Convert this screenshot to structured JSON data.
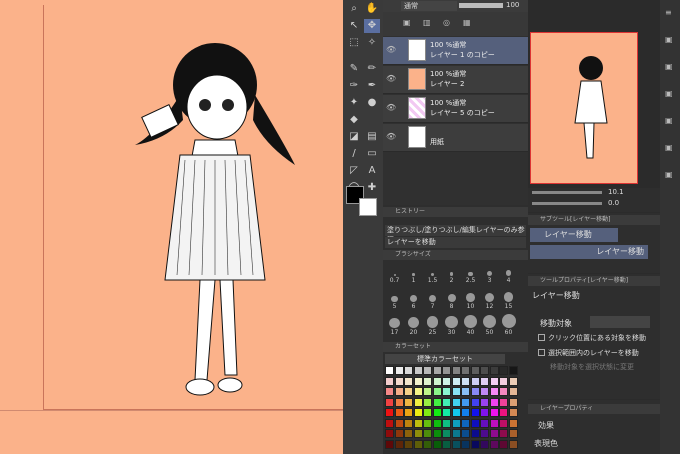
{
  "layer_panel": {
    "blend_mode": "通常",
    "opacity_value": "100",
    "layers": [
      {
        "line1": "100 %通常",
        "line2": "レイヤー 1 のコピー"
      },
      {
        "line1": "100 %通常",
        "line2": "レイヤー 2"
      },
      {
        "line1": "100 %通常",
        "line2": "レイヤー 5 のコピー"
      },
      {
        "line1": "",
        "line2": "用紙"
      }
    ]
  },
  "history": {
    "tab": "ヒストリー",
    "item1": "塗りつぶし/塗りつぶし/編集レイヤーのみ参照",
    "item2": "レイヤーを移動"
  },
  "brush_size": {
    "tab": "ブラシサイズ",
    "values": [
      "0.7",
      "1",
      "1.5",
      "2",
      "2.5",
      "3",
      "4",
      "5",
      "6",
      "7",
      "8",
      "10",
      "12",
      "15",
      "17",
      "20",
      "25",
      "30",
      "40",
      "50",
      "60"
    ]
  },
  "color_set": {
    "tab": "カラーセット",
    "set_name": "標準カラーセット"
  },
  "navigator": {
    "zoom": "10.1",
    "angle": "0.0"
  },
  "sub_tool": {
    "tab": "サブツール[レイヤー移動]",
    "item1": "レイヤー移動",
    "item2": "レイヤー移動"
  },
  "tool_property": {
    "tab": "ツールプロパティ[レイヤー移動]",
    "title": "レイヤー移動",
    "target_label": "移動対象",
    "chk1": "クリック位置にある対象を移動",
    "chk2": "選択範囲内のレイヤーを移動",
    "chk3": "移動対象を選択状態に変更"
  },
  "layer_property": {
    "tab": "レイヤープロパティ",
    "effect": "効果",
    "display_color": "表現色"
  },
  "colors": {
    "accent": "#55607c",
    "canvas": "#fbb28a"
  }
}
